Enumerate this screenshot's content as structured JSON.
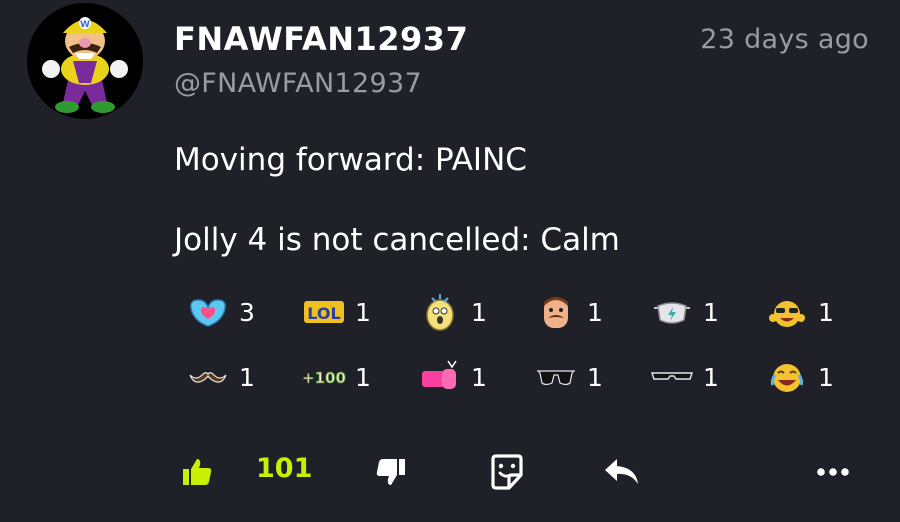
{
  "comment": {
    "author": {
      "display_name": "FNAWFAN12937",
      "handle": "@FNAWFAN12937",
      "avatar_icon": "wario-avatar-icon"
    },
    "timestamp": "23 days ago",
    "body_lines": [
      "Moving forward: PAINC",
      "Jolly 4 is not cancelled: Calm"
    ]
  },
  "reactions": [
    {
      "icon": "heart-hands-icon",
      "count": "3"
    },
    {
      "icon": "lol-sticker-icon",
      "count": "1"
    },
    {
      "icon": "shocked-egg-icon",
      "count": "1"
    },
    {
      "icon": "mustache-man-icon",
      "count": "1"
    },
    {
      "icon": "face-mask-icon",
      "count": "1"
    },
    {
      "icon": "sunglasses-laugh-icon",
      "count": "1"
    },
    {
      "icon": "mustache-icon",
      "count": "1"
    },
    {
      "icon": "plus-100-icon",
      "count": "1"
    },
    {
      "icon": "pink-fist-icon",
      "count": "1"
    },
    {
      "icon": "dark-sunglasses-icon",
      "count": "1"
    },
    {
      "icon": "thin-sunglasses-icon",
      "count": "1"
    },
    {
      "icon": "crying-laugh-icon",
      "count": "1"
    }
  ],
  "actions": {
    "like_count": "101",
    "like_icon": "thumbs-up-icon",
    "dislike_icon": "thumbs-down-icon",
    "react_icon": "sticker-icon",
    "reply_icon": "reply-icon",
    "more_icon": "more-icon"
  },
  "colors": {
    "background": "#202028",
    "like_accent": "#c8f000",
    "secondary_text": "#9a9aa2"
  }
}
